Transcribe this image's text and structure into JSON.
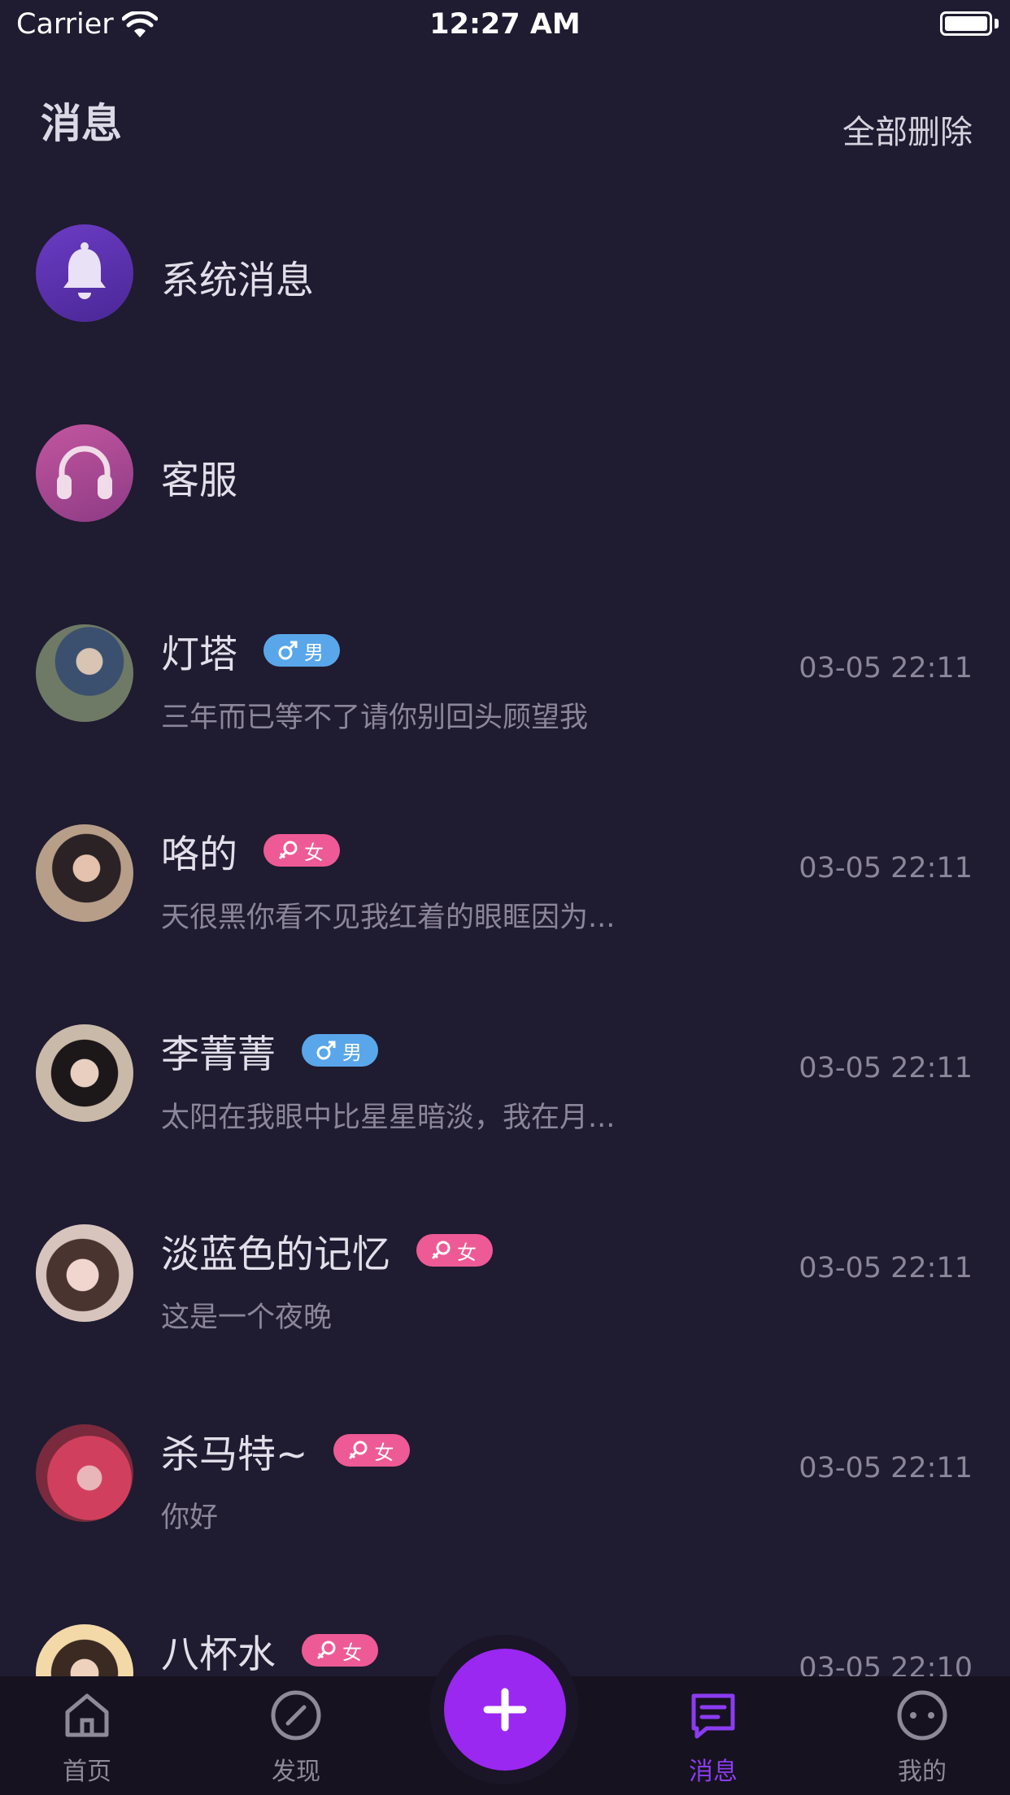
{
  "status_bar": {
    "carrier": "Carrier",
    "time": "12:27 AM"
  },
  "header": {
    "title": "消息",
    "delete_all": "全部删除"
  },
  "system_rows": [
    {
      "name": "系统消息",
      "icon": "bell-icon",
      "color": "#5a2fa8"
    },
    {
      "name": "客服",
      "icon": "headphones-icon",
      "color": "#b0488f"
    }
  ],
  "conversations": [
    {
      "name": "灯塔",
      "gender": "male",
      "gender_label": "男",
      "preview": "三年而已等不了请你别回头顾望我",
      "time": "03-05 22:11"
    },
    {
      "name": "咯的",
      "gender": "female",
      "gender_label": "女",
      "preview": "天很黑你看不见我红着的眼眶因为...",
      "time": "03-05 22:11"
    },
    {
      "name": "李菁菁",
      "gender": "male",
      "gender_label": "男",
      "preview": "太阳在我眼中比星星暗淡，我在月...",
      "time": "03-05 22:11"
    },
    {
      "name": "淡蓝色的记忆",
      "gender": "female",
      "gender_label": "女",
      "preview": "这是一个夜晚",
      "time": "03-05 22:11"
    },
    {
      "name": "杀马特~",
      "gender": "female",
      "gender_label": "女",
      "preview": "你好",
      "time": "03-05 22:11"
    },
    {
      "name": "八杯水",
      "gender": "female",
      "gender_label": "女",
      "preview": "",
      "time": "03-05 22:10"
    }
  ],
  "tabbar": {
    "home": "首页",
    "discover": "发现",
    "messages": "消息",
    "mine": "我的",
    "active_color": "#8b3cf0",
    "fab_color": "#9a28f0"
  }
}
